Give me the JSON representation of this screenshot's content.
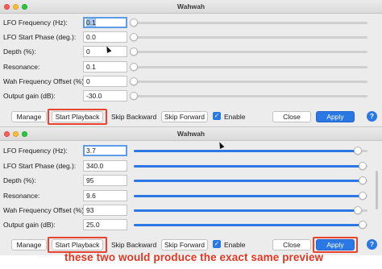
{
  "windows": [
    {
      "title": "Wahwah",
      "focused_field": 0,
      "params": [
        {
          "label": "LFO Frequency (Hz):",
          "value": "0.1",
          "slider": 0.0
        },
        {
          "label": "LFO Start Phase (deg.):",
          "value": "0.0",
          "slider": 0.0
        },
        {
          "label": "Depth (%):",
          "value": "0",
          "slider": 0.0
        },
        {
          "label": "Resonance:",
          "value": "0.1",
          "slider": 0.0
        },
        {
          "label": "Wah Frequency Offset (%):",
          "value": "0",
          "slider": 0.0
        },
        {
          "label": "Output gain (dB):",
          "value": "-30.0",
          "slider": 0.0
        }
      ],
      "buttons": {
        "manage": "Manage",
        "start_playback": "Start Playback",
        "skip_backward": "Skip Backward",
        "skip_forward": "Skip Forward",
        "enable": "Enable",
        "close": "Close",
        "apply": "Apply",
        "help": "?"
      }
    },
    {
      "title": "Wahwah",
      "focused_field": 0,
      "params": [
        {
          "label": "LFO Frequency (Hz):",
          "value": "3.7",
          "slider": 0.96
        },
        {
          "label": "LFO Start Phase (deg.):",
          "value": "340.0",
          "slider": 0.98
        },
        {
          "label": "Depth (%):",
          "value": "95",
          "slider": 0.98
        },
        {
          "label": "Resonance:",
          "value": "9.6",
          "slider": 0.98
        },
        {
          "label": "Wah Frequency Offset (%):",
          "value": "93",
          "slider": 0.96
        },
        {
          "label": "Output gain (dB):",
          "value": "25.0",
          "slider": 0.98
        }
      ],
      "buttons": {
        "manage": "Manage",
        "start_playback": "Start Playback",
        "skip_backward": "Skip Backward",
        "skip_forward": "Skip Forward",
        "enable": "Enable",
        "close": "Close",
        "apply": "Apply",
        "help": "?"
      }
    }
  ],
  "annotation": {
    "caption": "these two would produce the exact same preview",
    "color": "#e8321f"
  },
  "colors": {
    "accent": "#2b78e4",
    "highlight_box": "#e8432f"
  }
}
